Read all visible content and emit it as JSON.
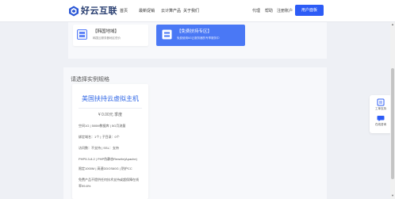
{
  "header": {
    "logo_text": "好云互联",
    "nav": [
      "首页",
      "最新促销",
      "云计算产品",
      "关于我们"
    ],
    "nav_right": [
      "代理",
      "帮助",
      "注册账户"
    ],
    "console_button": "用户面板"
  },
  "region_cards": [
    {
      "title": "【韩国地域】",
      "subtitle": "韩国云服务器地区低价",
      "active": false
    },
    {
      "title": "【免费扶持专区】",
      "subtitle": "免费使用6G云服务器的专享服务中",
      "active": true
    }
  ],
  "plans": {
    "section_label": "请选择实例规格",
    "items": [
      {
        "title": "美国扶持云虚拟主机",
        "price": "¥ 0.00元 季度",
        "specs": [
          "空间1G | 500M数据库 | 5G月流量",
          "绑定域名：1个 | 子目录：0个",
          "访问数：不支持 | SSL：支持",
          "PHP5.3-8.2 | PHP伪静态Rewrite(Apache)",
          "限定1000M | 高速DDOS60G | 防护CC",
          "免费产品不提供任何技术支持或超保障在线",
          "率99.8%"
        ]
      }
    ]
  },
  "float_bar": {
    "items": [
      "工单支持",
      "在线咨询"
    ]
  },
  "colors": {
    "accent": "#2d5cf6",
    "card_active": "#4a78f5",
    "plan_title": "#2f66e6",
    "page_bg": "#eef0f5"
  }
}
